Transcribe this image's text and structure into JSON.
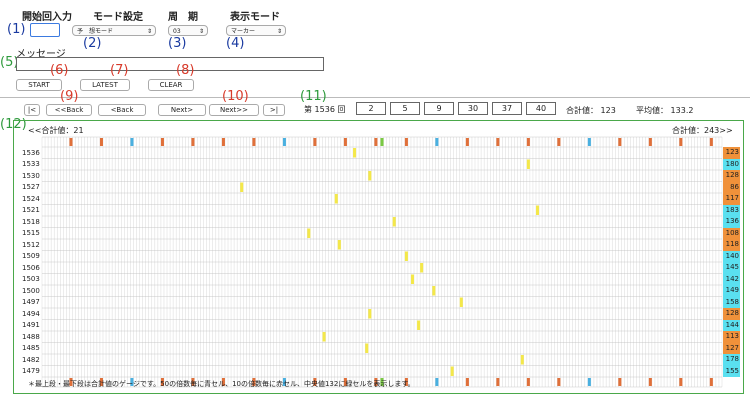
{
  "headers": {
    "start_input": "開始回入力",
    "mode_setting": "モード設定",
    "period": "周　期",
    "display_mode": "表示モード",
    "message": "メッセージ"
  },
  "callouts": {
    "c1": "(1)",
    "c2": "(2)",
    "c3": "(3)",
    "c4": "(4)",
    "c5": "(5)",
    "c6": "(6)",
    "c7": "(7)",
    "c8": "(8)",
    "c9": "(9)",
    "c10": "(10)",
    "c11": "(11)",
    "c12": "(12)"
  },
  "controls": {
    "start_value": "",
    "mode_value": "予　想モード",
    "period_value": "03",
    "display_value": "マーカー",
    "message_value": ""
  },
  "buttons": {
    "start": "START",
    "latest": "LATEST",
    "clear": "CLEAR",
    "first": "|<",
    "back_back": "<<Back",
    "back": "<Back",
    "next": "Next>",
    "next_next": "Next>>",
    "last": ">|"
  },
  "draw_info": {
    "prefix": "第",
    "draw_no": "1536",
    "suffix": "回",
    "numbers": [
      "2",
      "5",
      "9",
      "30",
      "37",
      "40"
    ],
    "sum_label": "合計値：",
    "sum_value": "123",
    "avg_label": "平均値：",
    "avg_value": "133.2"
  },
  "grid": {
    "left_label": "<<合計値：21",
    "right_label": "合計値：243>>",
    "footer_note": "＊最上段・最下段は合計値のゲージです。50の倍数毎に青セル、10の倍数毎に赤セル、中央値132に緑セルを表示します。",
    "colors": {
      "red_marker": "#e0703a",
      "blue_marker": "#4ab0e0",
      "green_marker": "#7ac943",
      "yellow_mark": "#f4e84a",
      "sum_orange": "#f0913a",
      "sum_cyan": "#5ae0f0",
      "frame_green": "#4aa84a"
    },
    "rows": [
      {
        "label": "1536",
        "sum": "123",
        "mark": 123,
        "sum_color": "orange"
      },
      {
        "label": "1533",
        "sum": "180",
        "mark": 180,
        "sum_color": "cyan"
      },
      {
        "label": "1530",
        "sum": "128",
        "mark": 128,
        "sum_color": "orange"
      },
      {
        "label": "1527",
        "sum": "86",
        "mark": 86,
        "sum_color": "orange"
      },
      {
        "label": "1524",
        "sum": "117",
        "mark": 117,
        "sum_color": "orange"
      },
      {
        "label": "1521",
        "sum": "183",
        "mark": 183,
        "sum_color": "cyan"
      },
      {
        "label": "1518",
        "sum": "136",
        "mark": 136,
        "sum_color": "cyan"
      },
      {
        "label": "1515",
        "sum": "108",
        "mark": 108,
        "sum_color": "orange"
      },
      {
        "label": "1512",
        "sum": "118",
        "mark": 118,
        "sum_color": "orange"
      },
      {
        "label": "1509",
        "sum": "140",
        "mark": 140,
        "sum_color": "cyan"
      },
      {
        "label": "1506",
        "sum": "145",
        "mark": 145,
        "sum_color": "cyan"
      },
      {
        "label": "1503",
        "sum": "142",
        "mark": 142,
        "sum_color": "cyan"
      },
      {
        "label": "1500",
        "sum": "149",
        "mark": 149,
        "sum_color": "cyan"
      },
      {
        "label": "1497",
        "sum": "158",
        "mark": 158,
        "sum_color": "cyan"
      },
      {
        "label": "1494",
        "sum": "128",
        "mark": 128,
        "sum_color": "orange"
      },
      {
        "label": "1491",
        "sum": "144",
        "mark": 144,
        "sum_color": "cyan"
      },
      {
        "label": "1488",
        "sum": "113",
        "mark": 113,
        "sum_color": "orange"
      },
      {
        "label": "1485",
        "sum": "127",
        "mark": 127,
        "sum_color": "orange"
      },
      {
        "label": "1482",
        "sum": "178",
        "mark": 178,
        "sum_color": "cyan"
      },
      {
        "label": "1479",
        "sum": "155",
        "mark": 155,
        "sum_color": "cyan"
      }
    ]
  }
}
